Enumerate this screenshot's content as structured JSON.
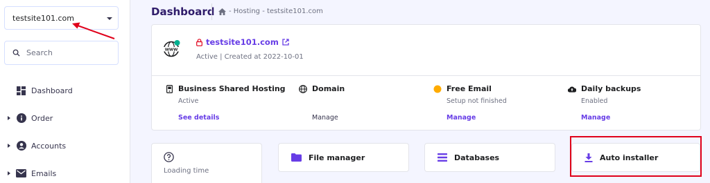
{
  "sidebar": {
    "site_selected": "testsite101.com",
    "search_placeholder": "Search",
    "items": [
      {
        "label": "Dashboard"
      },
      {
        "label": "Order"
      },
      {
        "label": "Accounts"
      },
      {
        "label": "Emails"
      }
    ]
  },
  "header": {
    "title": "Dashboard",
    "breadcrumb": "- Hosting - testsite101.com"
  },
  "site_card": {
    "domain": "testsite101.com",
    "status": "Active | Created at 2022-10-01",
    "features": [
      {
        "title": "Business Shared Hosting",
        "sub": "Active",
        "link": "See details"
      },
      {
        "title": "Domain",
        "sub": "",
        "link": "Manage"
      },
      {
        "title": "Free Email",
        "sub": "Setup not finished",
        "link": "Manage"
      },
      {
        "title": "Daily backups",
        "sub": "Enabled",
        "link": "Manage"
      }
    ]
  },
  "tiles": {
    "loading_time": "Loading time",
    "file_manager": "File manager",
    "databases": "Databases",
    "auto_installer": "Auto installer"
  },
  "colors": {
    "accent": "#673de6",
    "annotation": "#e0001a",
    "warning_dot": "#ffab00",
    "online_dot": "#00b090"
  }
}
